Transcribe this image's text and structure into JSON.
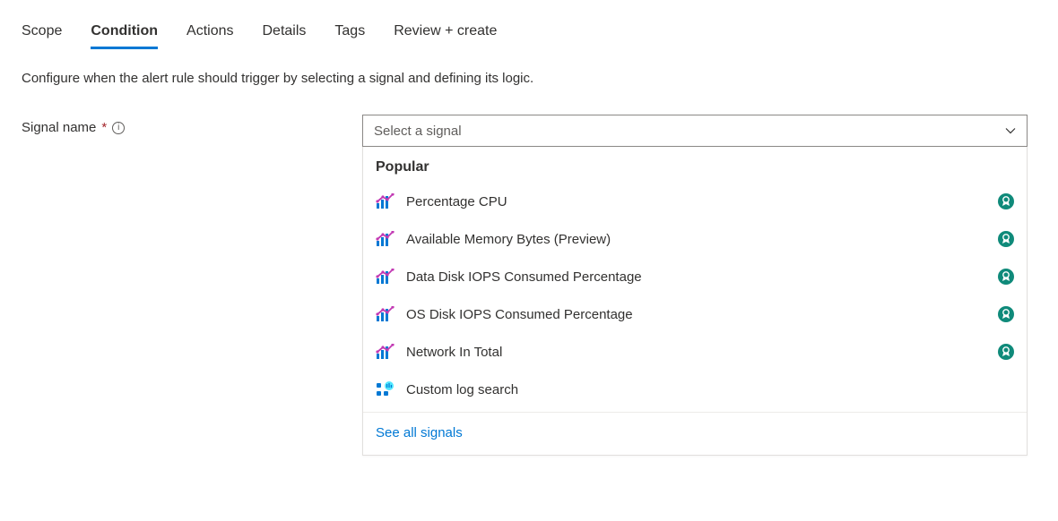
{
  "tabs": {
    "scope": "Scope",
    "condition": "Condition",
    "actions": "Actions",
    "details": "Details",
    "tags": "Tags",
    "review": "Review + create"
  },
  "description": "Configure when the alert rule should trigger by selecting a signal and defining its logic.",
  "field": {
    "label": "Signal name",
    "required": "*"
  },
  "dropdown": {
    "placeholder": "Select a signal",
    "header": "Popular",
    "options": [
      {
        "label": "Percentage CPU",
        "type": "metric",
        "badge": true
      },
      {
        "label": "Available Memory Bytes (Preview)",
        "type": "metric",
        "badge": true
      },
      {
        "label": "Data Disk IOPS Consumed Percentage",
        "type": "metric",
        "badge": true
      },
      {
        "label": "OS Disk IOPS Consumed Percentage",
        "type": "metric",
        "badge": true
      },
      {
        "label": "Network In Total",
        "type": "metric",
        "badge": true
      },
      {
        "label": "Custom log search",
        "type": "log",
        "badge": false
      }
    ],
    "see_all": "See all signals"
  }
}
